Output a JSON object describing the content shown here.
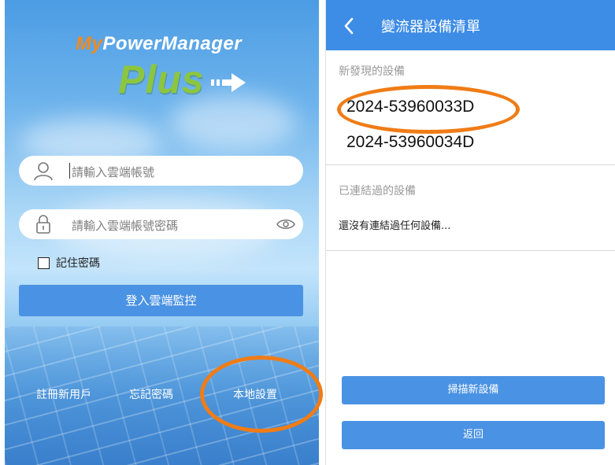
{
  "login": {
    "logo_my": "My",
    "logo_rest": "PowerManager",
    "logo_plus": "Plus",
    "account_placeholder": "請輸入雲端帳號",
    "password_placeholder": "請輸入雲端帳號密碼",
    "remember_label": "記住密碼",
    "login_button": "登入雲端監控",
    "register_link": "註冊新用戶",
    "forgot_link": "忘記密碼",
    "local_settings_link": "本地設置"
  },
  "device_list": {
    "title": "變流器設備清單",
    "new_devices_label": "新發現的設備",
    "new_devices": [
      "2024-53960033D",
      "2024-53960034D"
    ],
    "connected_label": "已連結過的設備",
    "connected_empty": "還沒有連結過任何設備...",
    "scan_button": "掃描新設備",
    "back_button": "返回"
  },
  "colors": {
    "primary_blue": "#3d8ce6",
    "button_blue": "#4a92e3",
    "highlight_orange": "#f07c16",
    "logo_green": "#8cc63f",
    "logo_orange": "#f08a1e"
  },
  "icons": [
    "user-icon",
    "lock-icon",
    "eye-icon",
    "arrow-logo-icon",
    "back-chevron-icon"
  ]
}
